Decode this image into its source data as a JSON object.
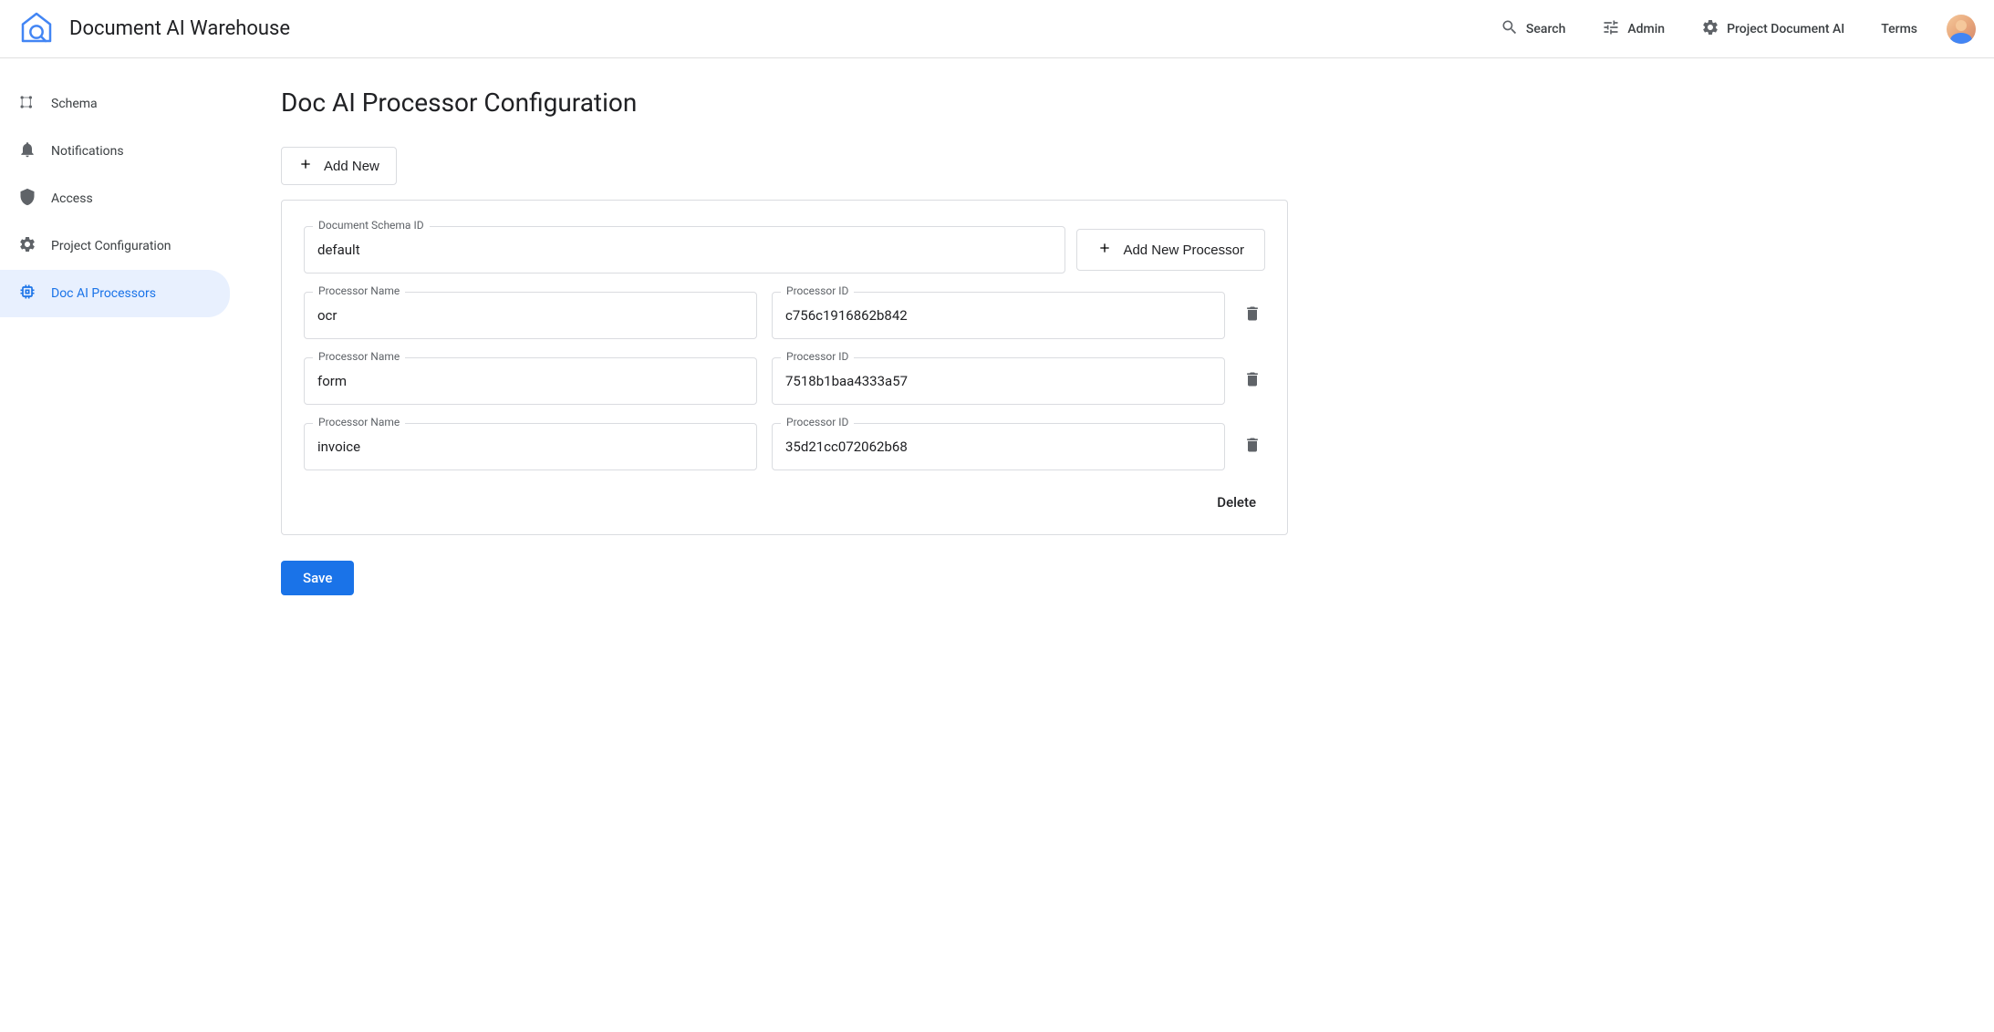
{
  "header": {
    "app_title": "Document AI Warehouse",
    "search_label": "Search",
    "admin_label": "Admin",
    "project_label": "Project Document AI",
    "terms_label": "Terms"
  },
  "sidebar": {
    "items": [
      {
        "label": "Schema"
      },
      {
        "label": "Notifications"
      },
      {
        "label": "Access"
      },
      {
        "label": "Project Configuration"
      },
      {
        "label": "Doc AI Processors"
      }
    ]
  },
  "main": {
    "page_title": "Doc AI Processor Configuration",
    "add_new_label": "Add New",
    "add_processor_label": "Add New Processor",
    "schema_id_label": "Document Schema ID",
    "schema_id_value": "default",
    "processor_name_label": "Processor Name",
    "processor_id_label": "Processor ID",
    "processors": [
      {
        "name": "ocr",
        "id": "c756c1916862b842"
      },
      {
        "name": "form",
        "id": "7518b1baa4333a57"
      },
      {
        "name": "invoice",
        "id": "35d21cc072062b68"
      }
    ],
    "delete_label": "Delete",
    "save_label": "Save"
  }
}
